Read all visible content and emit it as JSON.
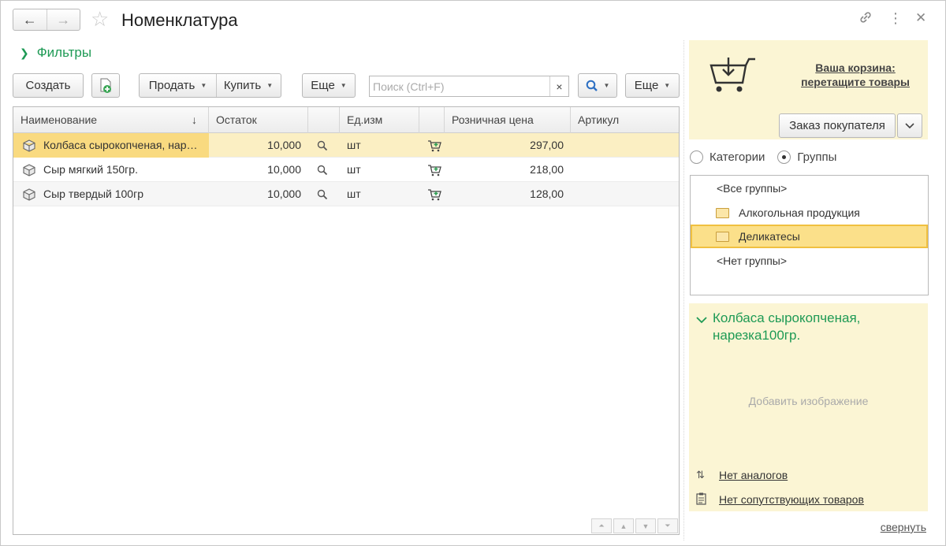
{
  "window": {
    "title": "Номенклатура"
  },
  "nav": {
    "back": "←",
    "forward": "→"
  },
  "filters": {
    "label": "Фильтры"
  },
  "toolbar": {
    "create_label": "Создать",
    "sell_label": "Продать",
    "buy_label": "Купить",
    "more1_label": "Еще",
    "more2_label": "Еще",
    "search_placeholder": "Поиск (Ctrl+F)",
    "clear": "×"
  },
  "table": {
    "columns": [
      "Наименование",
      "Остаток",
      "Ед.изм",
      "Розничная цена",
      "Артикул"
    ],
    "sort_indicator": "↓",
    "rows": [
      {
        "name": "Колбаса сырокопченая, нарезка100гр.",
        "stock": "10,000",
        "unit": "шт",
        "price": "297,00",
        "article": ""
      },
      {
        "name": "Сыр мягкий 150гр.",
        "stock": "10,000",
        "unit": "шт",
        "price": "218,00",
        "article": ""
      },
      {
        "name": "Сыр твердый 100гр",
        "stock": "10,000",
        "unit": "шт",
        "price": "128,00",
        "article": ""
      }
    ]
  },
  "cart": {
    "line1": "Ваша корзина:",
    "line2": "перетащите товары",
    "order_button": "Заказ покупателя"
  },
  "view_mode": {
    "categories": "Категории",
    "groups": "Группы",
    "selected": "groups"
  },
  "groups": [
    {
      "label": "<Все группы>",
      "folder": false
    },
    {
      "label": "Алкогольная продукция",
      "folder": true
    },
    {
      "label": "Деликатесы",
      "folder": true
    },
    {
      "label": "<Нет группы>",
      "folder": false
    }
  ],
  "details": {
    "title_line1": "Колбаса сырокопченая,",
    "title_line2": "нарезка100гр.",
    "add_image": "Добавить изображение",
    "analogs": "Нет аналогов",
    "related": "Нет сопутствующих товаров"
  },
  "footer": {
    "collapse": "свернуть"
  },
  "colors": {
    "accent_green": "#1e9a55",
    "selection": "#fbefc3",
    "panel": "#fbf5d4"
  }
}
